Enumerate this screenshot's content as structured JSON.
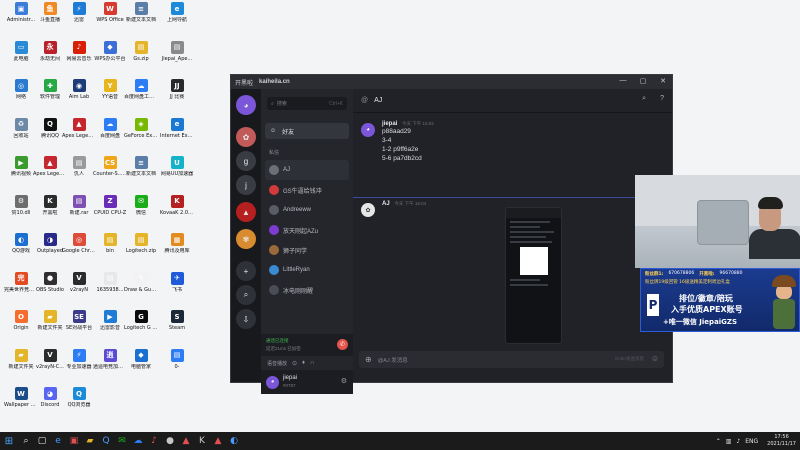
{
  "desktop": {
    "icons": [
      {
        "label": "Administr...",
        "glyph": "▣",
        "color": "#3b7dd8"
      },
      {
        "label": "斗鱼直播",
        "glyph": "鱼",
        "color": "#f08a24"
      },
      {
        "label": "迅雷",
        "glyph": "⚡",
        "color": "#1e7bd6"
      },
      {
        "label": "WPS Office",
        "glyph": "W",
        "color": "#d73a31"
      },
      {
        "label": "新建文本文档",
        "glyph": "≡",
        "color": "#5a7ea8"
      },
      {
        "label": "上网导航",
        "glyph": "e",
        "color": "#1c8ad9"
      },
      {
        "label": "此电脑",
        "glyph": "▭",
        "color": "#2a8ad6"
      },
      {
        "label": "永劫无间",
        "glyph": "永",
        "color": "#b8202a"
      },
      {
        "label": "网易云音乐",
        "glyph": "♪",
        "color": "#d81e06"
      },
      {
        "label": "WPS办公平台",
        "glyph": "◆",
        "color": "#3b6fd6"
      },
      {
        "label": "Gs.zip",
        "glyph": "▤",
        "color": "#e4b429"
      },
      {
        "label": "Jiepai_Ape...",
        "glyph": "▤",
        "color": "#8a8a8a"
      },
      {
        "label": "网络",
        "glyph": "◎",
        "color": "#2a7bd0"
      },
      {
        "label": "软件管理",
        "glyph": "✚",
        "color": "#27a844"
      },
      {
        "label": "Aim Lab",
        "glyph": "◉",
        "color": "#1d3d7a"
      },
      {
        "label": "YY语音",
        "glyph": "Y",
        "color": "#e7b51d"
      },
      {
        "label": "百度网盘工作台",
        "glyph": "☁",
        "color": "#2c7cf6"
      },
      {
        "label": "JJ 比赛",
        "glyph": "JJ",
        "color": "#2a2a2a"
      },
      {
        "label": "回收站",
        "glyph": "♻",
        "color": "#6c8aa8"
      },
      {
        "label": "腾讯QQ",
        "glyph": "Q",
        "color": "#111111"
      },
      {
        "label": "Apex Legends",
        "glyph": "▲",
        "color": "#c6262e"
      },
      {
        "label": "百度网盘",
        "glyph": "☁",
        "color": "#2c7cf6"
      },
      {
        "label": "GeForce Experience",
        "glyph": "◈",
        "color": "#76b900"
      },
      {
        "label": "Internet Explorer",
        "glyph": "e",
        "color": "#1b79d4"
      },
      {
        "label": "腾讯视频",
        "glyph": "▶",
        "color": "#3b9b2f"
      },
      {
        "label": "Apex Legends",
        "glyph": "▲",
        "color": "#c6262e"
      },
      {
        "label": "仇人",
        "glyph": "▤",
        "color": "#9a9a9a"
      },
      {
        "label": "Counter-S... Global Off...",
        "glyph": "CS",
        "color": "#f0a51a"
      },
      {
        "label": "新建文本文档",
        "glyph": "≡",
        "color": "#5a7ea8"
      },
      {
        "label": "网易UU加速器",
        "glyph": "U",
        "color": "#14b3c9"
      },
      {
        "label": "赞10.dll",
        "glyph": "⚙",
        "color": "#6d6d6d"
      },
      {
        "label": "开黑啦",
        "glyph": "K",
        "color": "#2c2c2c"
      },
      {
        "label": "新建.rar",
        "glyph": "▤",
        "color": "#7d4fb3"
      },
      {
        "label": "CPUID CPU-Z",
        "glyph": "Z",
        "color": "#6a2db8"
      },
      {
        "label": "微信",
        "glyph": "✉",
        "color": "#1aad19"
      },
      {
        "label": "KovaaK 2.0 The Meta",
        "glyph": "K",
        "color": "#b51f1f"
      },
      {
        "label": "QQ游戏",
        "glyph": "◐",
        "color": "#1b6fd0"
      },
      {
        "label": "Outplayed",
        "glyph": "◑",
        "color": "#2a2a8a"
      },
      {
        "label": "Google Chrome",
        "glyph": "◎",
        "color": "#dd4b39"
      },
      {
        "label": "bin",
        "glyph": "▤",
        "color": "#e4b429"
      },
      {
        "label": "Logitech.zip",
        "glyph": "▤",
        "color": "#e4b429"
      },
      {
        "label": "腾讯及用库",
        "glyph": "▦",
        "color": "#e38b1f"
      },
      {
        "label": "完美世界竞技平台",
        "glyph": "完",
        "color": "#e24a24"
      },
      {
        "label": "OBS Studio",
        "glyph": "●",
        "color": "#302e31"
      },
      {
        "label": "v2rayN",
        "glyph": "V",
        "color": "#2b2b2b"
      },
      {
        "label": "1635938...",
        "glyph": "▤",
        "color": "#e8e8e8"
      },
      {
        "label": "Draw & Guess",
        "glyph": "✎",
        "color": "#f2f2f2"
      },
      {
        "label": "飞书",
        "glyph": "✈",
        "color": "#1f5ad8"
      },
      {
        "label": "Origin",
        "glyph": "O",
        "color": "#f56c2d"
      },
      {
        "label": "新建文件夹",
        "glyph": "▰",
        "color": "#e4b429"
      },
      {
        "label": "SE对战平台",
        "glyph": "SE",
        "color": "#3b3b8a"
      },
      {
        "label": "迅雷影音",
        "glyph": "▶",
        "color": "#1e7bd6"
      },
      {
        "label": "Logitech G HUB",
        "glyph": "G",
        "color": "#0b0b0b"
      },
      {
        "label": "Steam",
        "glyph": "S",
        "color": "#1b2838"
      },
      {
        "label": "新建文件夹",
        "glyph": "▰",
        "color": "#e4b429"
      },
      {
        "label": "v2rayN-C...",
        "glyph": "V",
        "color": "#2b2b2b"
      },
      {
        "label": "专业加速器",
        "glyph": "⚡",
        "color": "#2c7cf6"
      },
      {
        "label": "逍遥电竞加速器",
        "glyph": "逍",
        "color": "#5a4bd6"
      },
      {
        "label": "电脑管家",
        "glyph": "◆",
        "color": "#1b6fd0"
      },
      {
        "label": "0-",
        "glyph": "▤",
        "color": "#2c7cf6"
      },
      {
        "label": "Wallpaper Engine: ...",
        "glyph": "W",
        "color": "#1b4d8a"
      },
      {
        "label": "Discord",
        "glyph": "◕",
        "color": "#5865f2"
      },
      {
        "label": "QQ浏览器",
        "glyph": "Q",
        "color": "#1b8ad9"
      }
    ]
  },
  "app": {
    "brand": "开黑啦",
    "url": "kaiheila.cn",
    "rail_servers": [
      {
        "glyph": "◕",
        "color": "#7b56d9"
      },
      {
        "glyph": "✿",
        "color": "#c25a5a"
      },
      {
        "glyph": "g",
        "color": "#3a3c43"
      },
      {
        "glyph": "j",
        "color": "#3a3c43"
      },
      {
        "glyph": "▲",
        "color": "#b51f1f"
      },
      {
        "glyph": "✾",
        "color": "#d98c2f"
      },
      {
        "glyph": "+",
        "color": "#2f3138"
      },
      {
        "glyph": "⌕",
        "color": "#2f3138"
      },
      {
        "glyph": "⇩",
        "color": "#2f3138"
      }
    ],
    "search": {
      "placeholder": "搜索",
      "shortcut": "Ctrl+K"
    },
    "friends_label": "好友",
    "dm_header": "私信",
    "dms": [
      {
        "name": "AJ",
        "color": "#6c6f78",
        "active": true
      },
      {
        "name": "GS牛逼给钱冲",
        "color": "#d23b3b",
        "active": false
      },
      {
        "name": "Andreeww",
        "color": "#5a5d66",
        "active": false
      },
      {
        "name": "放天刚起AZu",
        "color": "#7d3bd2",
        "active": false
      },
      {
        "name": "狮子同学",
        "color": "#9a6a3a",
        "active": false
      },
      {
        "name": "LittleRyan",
        "color": "#3a8ad2",
        "active": false
      },
      {
        "name": "冰电刚刚醒",
        "color": "#4a4d56",
        "active": false
      }
    ],
    "voice": {
      "status": "通话已连接",
      "detail": "延迟21ms 已加密"
    },
    "audio_label": "语音播放",
    "user": {
      "name": "jiepai",
      "tag": "#0787"
    },
    "chat": {
      "title": "AJ",
      "messages": [
        {
          "author": "jiepai",
          "time": "今天 下午 15:02",
          "lines": [
            "p88aad29",
            "3-4",
            "1-2  p9ff6a2e",
            "5-6 pa7db2cd"
          ]
        },
        {
          "author": "AJ",
          "time": "今天 下午 15:04",
          "lines": []
        }
      ],
      "composer_placeholder": "@AJ 发消息",
      "composer_hint": "Enter发送消息"
    }
  },
  "overlay": {
    "banner": {
      "line0_label1": "粉丝群1:",
      "line0_val1": "670678806",
      "line0_label2": "开黑啦:",
      "line0_val2": "96670880",
      "line1": "粉丝牌19级回管  16级送精美定制周边礼盒",
      "line2": "排位/徽章/陪玩",
      "line3": "入手优质APEX账号",
      "line4": "+唯一微信 JiepaiGZS"
    }
  },
  "taskbar": {
    "time": "17:56",
    "date": "2021/11/17",
    "lang": "ENG"
  }
}
